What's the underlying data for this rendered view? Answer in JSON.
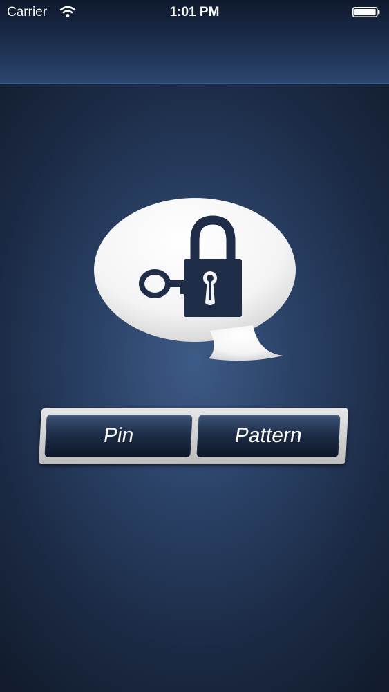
{
  "status_bar": {
    "carrier": "Carrier",
    "time": "1:01 PM",
    "icons": [
      "wifi-icon",
      "battery-icon"
    ]
  },
  "logo": {
    "icon": "speech-bubble-lock-key-icon"
  },
  "lock_type_selector": {
    "options": [
      {
        "label": "Pin"
      },
      {
        "label": "Pattern"
      }
    ]
  },
  "colors": {
    "background_center": "#3d5b87",
    "background_edge": "#121c2e",
    "bubble": "#ffffff",
    "lock_icon": "#1f2d48",
    "button_fill": "#1e2e4a",
    "segment_frame": "#d6d6d6"
  }
}
